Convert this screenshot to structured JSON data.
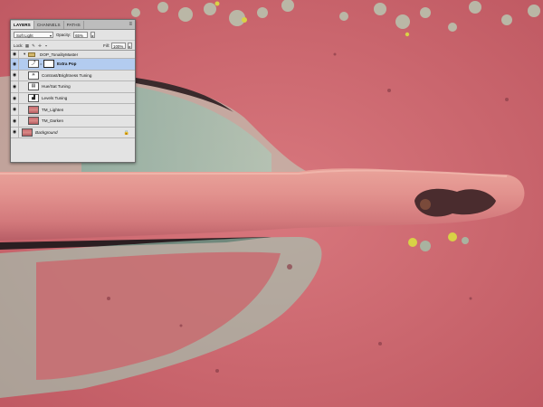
{
  "panel": {
    "tabs": [
      {
        "label": "LAYERS",
        "active": true
      },
      {
        "label": "CHANNELS",
        "active": false
      },
      {
        "label": "PATHS",
        "active": false
      }
    ],
    "menu_icon": "panel-menu-icon",
    "blend_mode": "Soft Light",
    "opacity_label": "Opacity:",
    "opacity_value": "65%",
    "lock_label": "Lock:",
    "fill_label": "Fill:",
    "fill_value": "100%"
  },
  "layers": [
    {
      "name": "DOP_TonalityMaster",
      "type": "group",
      "visible": true,
      "expanded": true
    },
    {
      "name": "Extra Pop",
      "type": "adjustment",
      "visible": true,
      "selected": true,
      "icon": "curves-icon"
    },
    {
      "name": "Contrast/Brightness Tuning",
      "type": "adjustment",
      "visible": true,
      "icon": "brightness-contrast-icon"
    },
    {
      "name": "Hue/Sat Tuning",
      "type": "adjustment",
      "visible": true,
      "icon": "hue-saturation-icon"
    },
    {
      "name": "Levels Tuning",
      "type": "adjustment",
      "visible": true,
      "icon": "levels-icon"
    },
    {
      "name": "TM_Lighten",
      "type": "pixel",
      "visible": true
    },
    {
      "name": "TM_Darken",
      "type": "pixel",
      "visible": true
    },
    {
      "name": "Background",
      "type": "background",
      "visible": true,
      "locked": true
    }
  ],
  "colors": {
    "paint_red": "#c9646b",
    "patina_teal": "#8fc7b2",
    "rust_dark": "#4a2c2e",
    "selection": "#b3ccf0"
  }
}
